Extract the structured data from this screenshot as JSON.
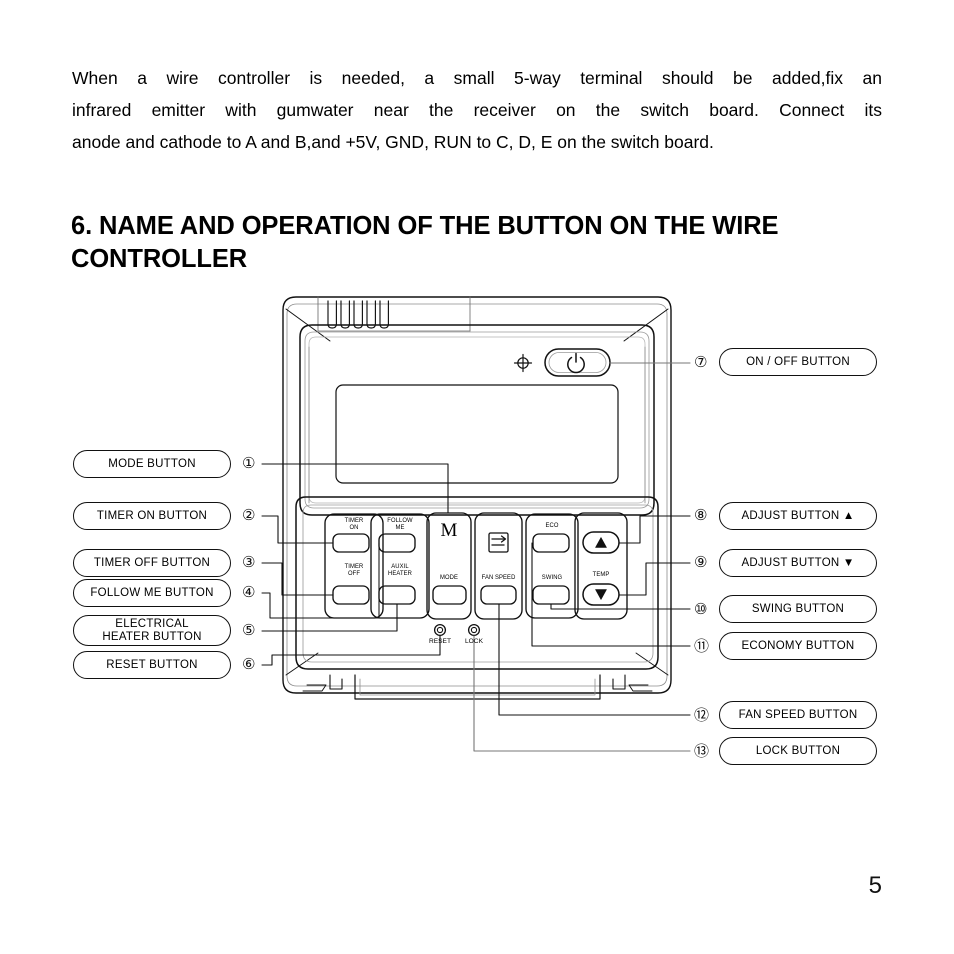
{
  "document": {
    "page_number": "5",
    "paragraph_lines": [
      "When a wire controller is needed, a small 5-way terminal should be added,fix an",
      "infrared emitter with gumwater near the receiver on the switch board. Connect its",
      "anode and cathode to A and B,and +5V, GND, RUN to C, D, E on the switch board."
    ],
    "heading": "6. NAME AND OPERATION OF THE BUTTON ON THE WIRE CONTROLLER"
  },
  "figure": {
    "title": "wire-controller-button-diagram",
    "callouts_left": [
      {
        "index": "①",
        "label": "MODE BUTTON"
      },
      {
        "index": "②",
        "label": "TIMER ON BUTTON"
      },
      {
        "index": "③",
        "label": "TIMER OFF BUTTON"
      },
      {
        "index": "④",
        "label": "FOLLOW ME BUTTON"
      },
      {
        "index": "⑤",
        "label": "ELECTRICAL\nHEATER BUTTON",
        "line1": "ELECTRICAL",
        "line2": "HEATER BUTTON"
      },
      {
        "index": "⑥",
        "label": "RESET BUTTON"
      }
    ],
    "callouts_right": [
      {
        "index": "⑦",
        "label": "ON / OFF BUTTON"
      },
      {
        "index": "⑧",
        "label": "ADJUST BUTTON ▲"
      },
      {
        "index": "⑨",
        "label": "ADJUST BUTTON ▼"
      },
      {
        "index": "⑩",
        "label": "SWING BUTTON"
      },
      {
        "index": "⑪",
        "label": "ECONOMY BUTTON"
      },
      {
        "index": "⑫",
        "label": "FAN SPEED BUTTON"
      },
      {
        "index": "⑬",
        "label": "LOCK BUTTON"
      }
    ],
    "device": {
      "power_icon": "power-icon",
      "fan_speed_icon": "fan-speed-icon",
      "mode_glyph": "M",
      "face_labels": {
        "timer_on_top": "TIMER",
        "timer_on_bottom": "ON",
        "timer_off_top": "TIMER",
        "timer_off_bottom": "OFF",
        "follow_me_top": "FOLLOW",
        "follow_me_bottom": "ME",
        "auxil_heater_top": "AUXIL",
        "auxil_heater_bottom": "HEATER",
        "mode": "MODE",
        "fan_speed": "FAN SPEED",
        "eco": "ECO",
        "swing": "SWING",
        "temp": "TEMP",
        "up_arrow": "▲",
        "down_arrow": "▼"
      },
      "pinholes": [
        {
          "name": "reset",
          "label": "RESET"
        },
        {
          "name": "lock",
          "label": "LOCK"
        }
      ]
    }
  },
  "colors": {
    "ink": "#111111",
    "leader": "#555555",
    "page_bg": "#ffffff"
  }
}
